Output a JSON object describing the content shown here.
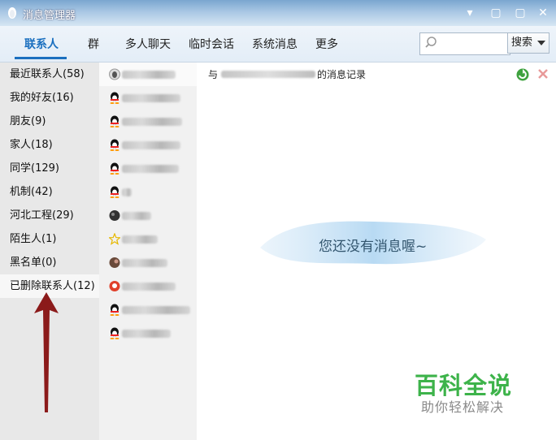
{
  "window": {
    "title": "消息管理器",
    "controls": {
      "minimize": "▾",
      "maximize": "▢",
      "close": "✕"
    }
  },
  "tabs": [
    "联系人",
    "群",
    "多人聊天",
    "临时会话",
    "系统消息",
    "更多"
  ],
  "active_tab": "联系人",
  "search": {
    "placeholder": "",
    "button_label": "搜索"
  },
  "sidebar": {
    "items": [
      {
        "label": "最近联系人(58)"
      },
      {
        "label": "我的好友(16)"
      },
      {
        "label": "朋友(9)"
      },
      {
        "label": "家人(18)"
      },
      {
        "label": "同学(129)"
      },
      {
        "label": "机制(42)"
      },
      {
        "label": "河北工程(29)"
      },
      {
        "label": "陌生人(1)"
      },
      {
        "label": "黑名单(0)"
      },
      {
        "label": "已删除联系人(12)"
      }
    ],
    "selected": "已删除联系人(12)"
  },
  "contacts": [
    {
      "avatar": "penguin-gray-icon"
    },
    {
      "avatar": "qq-penguin-icon"
    },
    {
      "avatar": "qq-penguin-icon"
    },
    {
      "avatar": "qq-penguin-icon"
    },
    {
      "avatar": "qq-penguin-icon"
    },
    {
      "avatar": "qq-penguin-icon"
    },
    {
      "avatar": "dark-avatar-icon"
    },
    {
      "avatar": "star-icon"
    },
    {
      "avatar": "photo-avatar-icon"
    },
    {
      "avatar": "red-avatar-icon"
    },
    {
      "avatar": "qq-penguin-icon"
    },
    {
      "avatar": "qq-penguin-icon"
    }
  ],
  "main": {
    "record_prefix": "与",
    "record_suffix": "的消息记录",
    "empty_message": "您还没有消息喔~"
  },
  "watermark": {
    "title": "百科全说",
    "subtitle": "助你轻松解决"
  },
  "colors": {
    "accent": "#1a6fbf",
    "arrow": "#8b1a1a",
    "watermark_green": "#3db34a"
  }
}
